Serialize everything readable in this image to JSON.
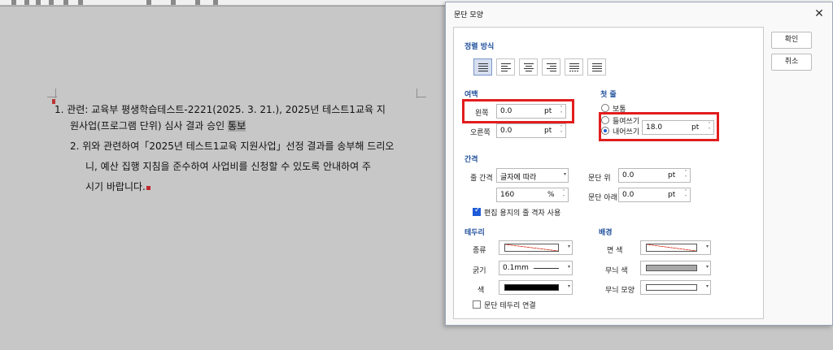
{
  "document": {
    "item1_line1": "1. 관련: 교육부 평생학습테스트-2221(2025. 3. 21.), 2025년 테스트1교육 지",
    "item1_line2_pre": "원사업(프로그램 단위) 심사 결과 승인 ",
    "item1_line2_hl": "통보",
    "item2_line1": "2. 위와 관련하여「2025년 테스트1교육 지원사업」선정 결과를 송부해 드리오",
    "item2_line2": "니, 예산 집행 지침을 준수하여 사업비를 신청할 수 있도록 안내하여 주",
    "item2_line3": "시기 바랍니다."
  },
  "dialog": {
    "title": "문단 모양",
    "ok_label": "확인",
    "cancel_label": "취소",
    "alignment": {
      "title": "정렬 방식",
      "options": [
        "justify",
        "left",
        "center",
        "right",
        "distribute",
        "divide"
      ],
      "selected": "justify"
    },
    "margin": {
      "title": "여백",
      "left_label": "왼쪽",
      "left_value": "0.0",
      "right_label": "오른쪽",
      "right_value": "0.0",
      "unit": "pt"
    },
    "first_line": {
      "title": "첫 줄",
      "normal_label": "보통",
      "indent_label": "들여쓰기",
      "hanging_label": "내어쓰기",
      "selected": "hanging",
      "value": "18.0",
      "unit": "pt"
    },
    "spacing": {
      "title": "간격",
      "line_spacing_label": "줄 간격",
      "line_spacing_mode": "글자에 따라",
      "line_spacing_value": "160",
      "line_spacing_unit": "%",
      "above_label": "문단 위",
      "above_value": "0.0",
      "below_label": "문단 아래",
      "below_value": "0.0",
      "unit": "pt",
      "grid_checkbox_label": "편집 용지의 줄 격자 사용",
      "grid_checked": true
    },
    "border": {
      "title": "테두리",
      "type_label": "종류",
      "thickness_label": "굵기",
      "thickness_value": "0.1mm",
      "color_label": "색",
      "connect_label": "문단 테두리 연결",
      "connect_checked": false
    },
    "background": {
      "title": "배경",
      "face_color_label": "면 색",
      "pattern_color_label": "무늬 색",
      "pattern_shape_label": "무늬 모양"
    }
  },
  "colors": {
    "highlight_box": "#e21d1d",
    "section_title": "#1f4e9a",
    "accent": "#1f5bd6"
  }
}
